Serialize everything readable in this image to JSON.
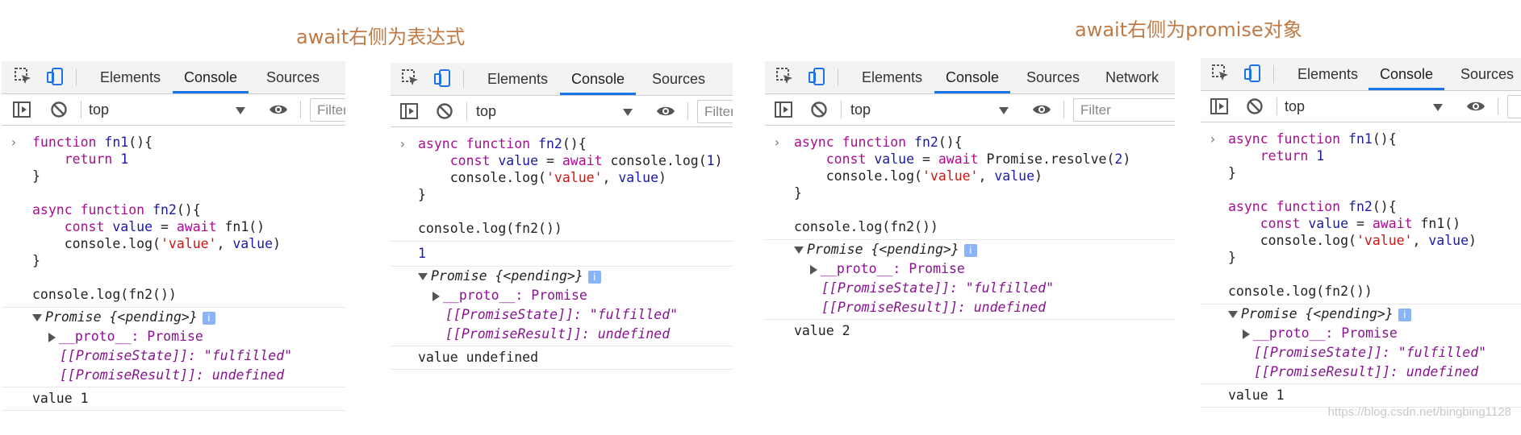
{
  "headings": {
    "left": "await右侧为表达式",
    "right": "await右侧为promise对象"
  },
  "devtools": {
    "tabs": [
      "Elements",
      "Console",
      "Sources",
      "Network"
    ],
    "context": "top",
    "filter_placeholder": "Filter"
  },
  "panels": [
    {
      "code": [
        "function fn1(){",
        "    return 1",
        "}",
        "",
        "async function fn2(){",
        "    const value = await fn1()",
        "    console.log('value', value)",
        "}",
        "",
        "console.log(fn2())"
      ],
      "outputs": [
        "Promise {<pending>}",
        "__proto__: Promise",
        "[[PromiseState]]: \"fulfilled\"",
        "[[PromiseResult]]: undefined",
        "value 1"
      ]
    },
    {
      "code": [
        "async function fn2(){",
        "    const value = await console.log(1)",
        "    console.log('value', value)",
        "}",
        "",
        "console.log(fn2())"
      ],
      "outputs": [
        "1",
        "Promise {<pending>}",
        "__proto__: Promise",
        "[[PromiseState]]: \"fulfilled\"",
        "[[PromiseResult]]: undefined",
        "value undefined"
      ]
    },
    {
      "code": [
        "async function fn2(){",
        "    const value = await Promise.resolve(2)",
        "    console.log('value', value)",
        "}",
        "",
        "console.log(fn2())"
      ],
      "outputs": [
        "Promise {<pending>}",
        "__proto__: Promise",
        "[[PromiseState]]: \"fulfilled\"",
        "[[PromiseResult]]: undefined",
        "value 2"
      ]
    },
    {
      "code": [
        "async function fn1(){",
        "    return 1",
        "}",
        "",
        "async function fn2(){",
        "    const value = await fn1()",
        "    console.log('value', value)",
        "}",
        "",
        "console.log(fn2())"
      ],
      "outputs": [
        "Promise {<pending>}",
        "__proto__: Promise",
        "[[PromiseState]]: \"fulfilled\"",
        "[[PromiseResult]]: undefined",
        "value 1"
      ]
    }
  ],
  "watermark": "https://blog.csdn.net/bingbing1128"
}
